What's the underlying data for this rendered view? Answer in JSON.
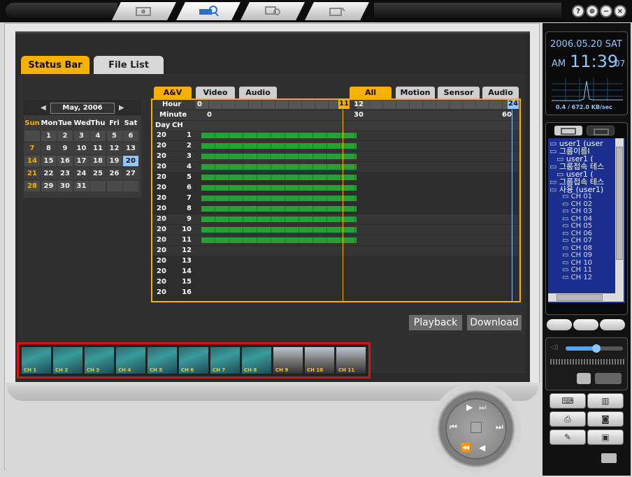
{
  "window": {
    "controls": [
      "?",
      "⊕",
      "−",
      "×"
    ]
  },
  "main_tabs": [
    {
      "label": "Status Bar",
      "active": true
    },
    {
      "label": "File List",
      "active": false
    }
  ],
  "calendar": {
    "month_label": "May, 2006",
    "weekdays": [
      "Sun",
      "Mon",
      "Tue",
      "Wed",
      "Thu",
      "Fri",
      "Sat"
    ],
    "weeks": [
      [
        "",
        "1",
        "2",
        "3",
        "4",
        "5",
        "6"
      ],
      [
        "7",
        "8",
        "9",
        "10",
        "11",
        "12",
        "13"
      ],
      [
        "14",
        "15",
        "16",
        "17",
        "18",
        "19",
        "20"
      ],
      [
        "21",
        "22",
        "23",
        "24",
        "25",
        "26",
        "27"
      ],
      [
        "28",
        "29",
        "30",
        "31",
        "",
        "",
        ""
      ]
    ],
    "selected_day": "20"
  },
  "left_subtabs": [
    "A&V",
    "Video",
    "Audio"
  ],
  "right_subtabs": [
    "All",
    "Motion",
    "Sensor",
    "Audio"
  ],
  "grid": {
    "hour_label": "Hour",
    "minute_label": "Minute",
    "day_header": "Day",
    "ch_header": "CH",
    "hour_start": "0",
    "hour_current": "11",
    "hour_next": "12",
    "hour_end": "24",
    "minute_start": "0",
    "minute_mid": "30",
    "minute_end": "60",
    "rows": [
      {
        "day": "20",
        "ch": "1",
        "recorded": true
      },
      {
        "day": "20",
        "ch": "2",
        "recorded": true
      },
      {
        "day": "20",
        "ch": "3",
        "recorded": true
      },
      {
        "day": "20",
        "ch": "4",
        "recorded": true
      },
      {
        "day": "20",
        "ch": "5",
        "recorded": true
      },
      {
        "day": "20",
        "ch": "6",
        "recorded": true
      },
      {
        "day": "20",
        "ch": "7",
        "recorded": true
      },
      {
        "day": "20",
        "ch": "8",
        "recorded": true
      },
      {
        "day": "20",
        "ch": "9",
        "recorded": true
      },
      {
        "day": "20",
        "ch": "10",
        "recorded": true
      },
      {
        "day": "20",
        "ch": "11",
        "recorded": true
      },
      {
        "day": "20",
        "ch": "12",
        "recorded": false
      },
      {
        "day": "20",
        "ch": "13",
        "recorded": false
      },
      {
        "day": "20",
        "ch": "14",
        "recorded": false
      },
      {
        "day": "20",
        "ch": "15",
        "recorded": false
      },
      {
        "day": "20",
        "ch": "16",
        "recorded": false
      }
    ]
  },
  "actions": {
    "playback": "Playback",
    "download": "Download"
  },
  "thumbnails": [
    "CH 1",
    "CH 2",
    "CH 3",
    "CH 4",
    "CH 5",
    "CH 6",
    "CH 7",
    "CH 8",
    "CH 9",
    "CH 10",
    "CH 11"
  ],
  "clock": {
    "date": "2006.05.20 SAT",
    "ampm": "AM",
    "time": "11:39",
    "seconds": "07",
    "bandwidth": "0.4 / 672.0 KB/sec"
  },
  "tree": {
    "items": [
      "user1 (user",
      "그룹이름I",
      "user1 (",
      "그룹접속 테스",
      "user1 (",
      "그룹접속 테스",
      "사용 (user1)"
    ],
    "channels": [
      "CH 01",
      "CH 02",
      "CH 03",
      "CH 04",
      "CH 05",
      "CH 06",
      "CH 07",
      "CH 08",
      "CH 09",
      "CH 10",
      "CH 11",
      "CH 12"
    ]
  },
  "colors": {
    "accent": "#f5b000",
    "recording": "#27a035",
    "selection": "#e01010",
    "clock_text": "#8fc8ff"
  }
}
